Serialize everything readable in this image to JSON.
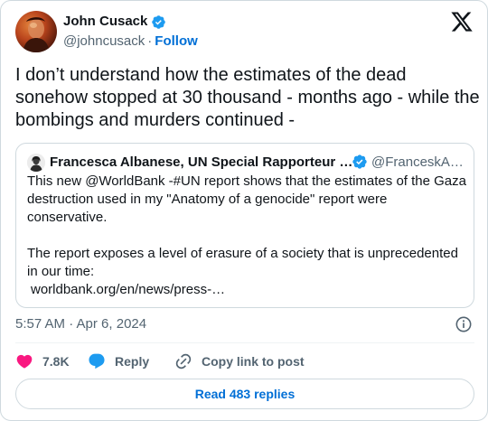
{
  "author": {
    "name": "John Cusack",
    "handle": "@johncusack",
    "separator": "·",
    "follow_label": "Follow",
    "verified_icon": "verified-badge-icon"
  },
  "brand_icon": "x-logo-icon",
  "tweet": {
    "text": "I don’t understand how the estimates of the dead sonehow stopped at 30 thousand - months ago - while the bombings and murders continued -"
  },
  "quote": {
    "name": "Francesca Albanese, UN Special Rapporteur …",
    "handle": "@FranceskA…",
    "paragraph_1": "This new @WorldBank -#UN report shows that the estimates of the Gaza destruction used in my \"Anatomy of a genocide\" report were conservative.",
    "paragraph_2": "The report exposes a level of erasure of a society that is unprecedented in our time:",
    "link": "worldbank.org/en/news/press-…"
  },
  "timestamp": "5:57 AM · Apr 6, 2024",
  "actions": {
    "like_count": "7.8K",
    "reply_label": "Reply",
    "copy_label": "Copy link to post"
  },
  "read_replies_label": "Read 483 replies",
  "colors": {
    "verified": "#1d9bf0",
    "like": "#f91880",
    "reply": "#1d9bf0",
    "link": "#006fd6",
    "secondary_text": "#536471",
    "border": "#cfd9de"
  }
}
